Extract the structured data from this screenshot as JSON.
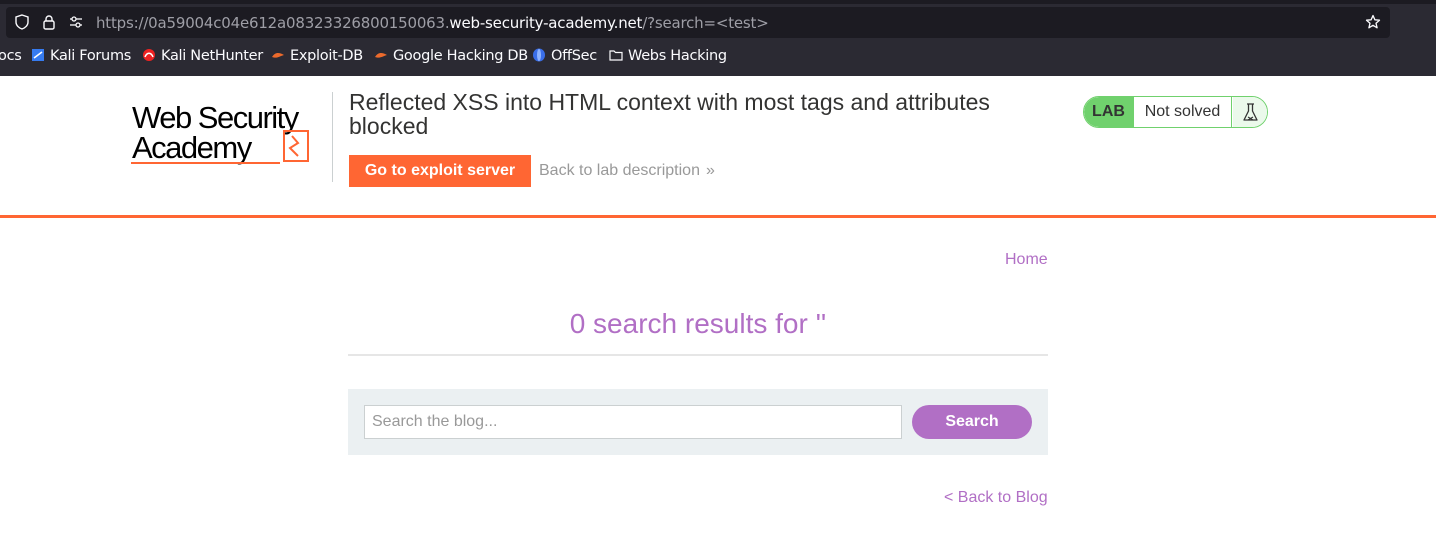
{
  "browser": {
    "url_prefix": "https://0a59004c04e612a08323326800150063.",
    "url_host": "web-security-academy.net",
    "url_suffix": "/?search=<test>",
    "bookmarks": [
      {
        "label": "ocs",
        "icon": "docs-icon"
      },
      {
        "label": "Kali Forums",
        "icon": "kali-forums-icon"
      },
      {
        "label": "Kali NetHunter",
        "icon": "kali-nethunter-icon"
      },
      {
        "label": "Exploit-DB",
        "icon": "exploit-db-icon"
      },
      {
        "label": "Google Hacking DB",
        "icon": "ghdb-icon"
      },
      {
        "label": "OffSec",
        "icon": "offsec-icon"
      },
      {
        "label": "Webs Hacking",
        "icon": "folder-icon"
      }
    ]
  },
  "header": {
    "logo_line1": "Web Security",
    "logo_line2": "Academy",
    "lab_title": "Reflected XSS into HTML context with most tags and attributes blocked",
    "exploit_button": "Go to exploit server",
    "back_to_lab": "Back to lab description",
    "back_chevron": "»",
    "lab_badge": "LAB",
    "lab_status": "Not solved"
  },
  "nav": {
    "home": "Home"
  },
  "main": {
    "results_heading": "0 search results for ''",
    "search_placeholder": "Search the blog...",
    "search_value": "",
    "search_button": "Search",
    "back_to_blog": "< Back to Blog"
  },
  "colors": {
    "accent_orange": "#ff6633",
    "link_purple": "#b16fc5",
    "status_green": "#70d16d"
  }
}
